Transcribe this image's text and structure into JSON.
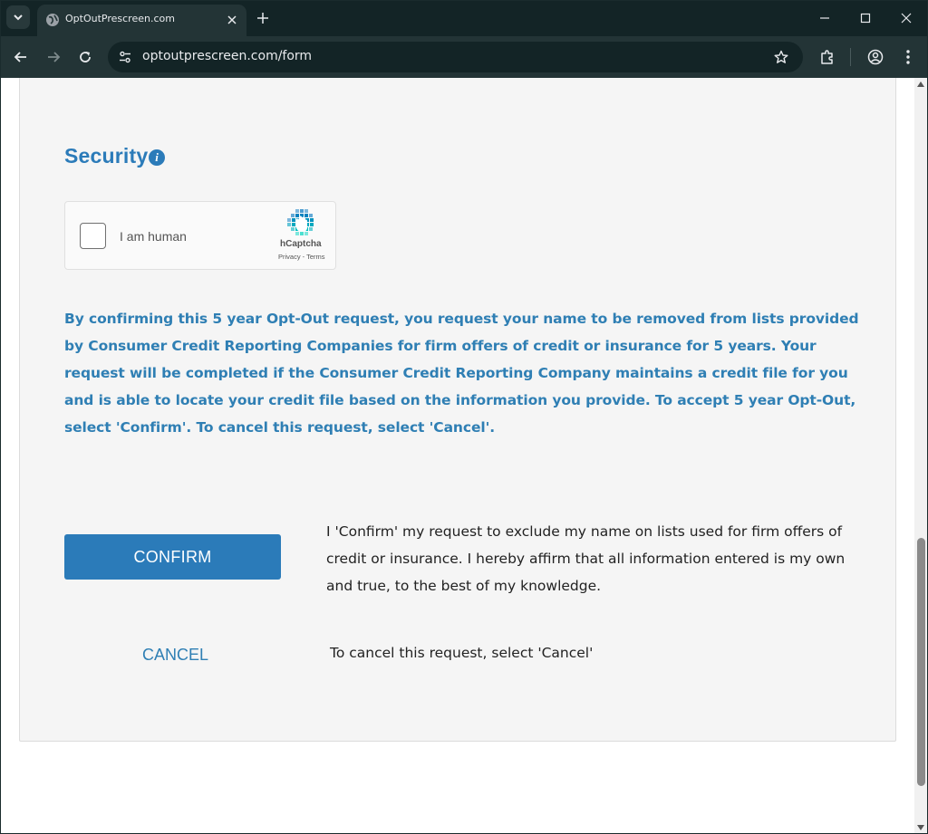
{
  "browser": {
    "tab_title": "OptOutPrescreen.com",
    "url": "optoutprescreen.com/form"
  },
  "security": {
    "title": "Security",
    "info_glyph": "i"
  },
  "captcha": {
    "label": "I am human",
    "brand": "hCaptcha",
    "links": "Privacy - Terms"
  },
  "notice": "By confirming this 5 year Opt-Out request, you request your name to be removed from lists provided by Consumer Credit Reporting Companies for firm offers of credit or insurance for 5 years. Your request will be completed if the Consumer Credit Reporting Company maintains a credit file for you and is able to locate your credit file based on the information you provide. To accept 5 year Opt-Out, select 'Confirm'. To cancel this request, select 'Cancel'.",
  "confirm": {
    "label": "CONFIRM",
    "text": "I 'Confirm' my request to exclude my name on lists used for firm offers of credit or insurance. I hereby affirm that all information entered is my own and true, to the best of my knowledge."
  },
  "cancel": {
    "label": "CANCEL",
    "text": "To cancel this request, select 'Cancel'"
  },
  "colors": {
    "accent": "#2b7bb9",
    "chrome_dark": "#132426",
    "chrome_toolbar": "#233436"
  }
}
